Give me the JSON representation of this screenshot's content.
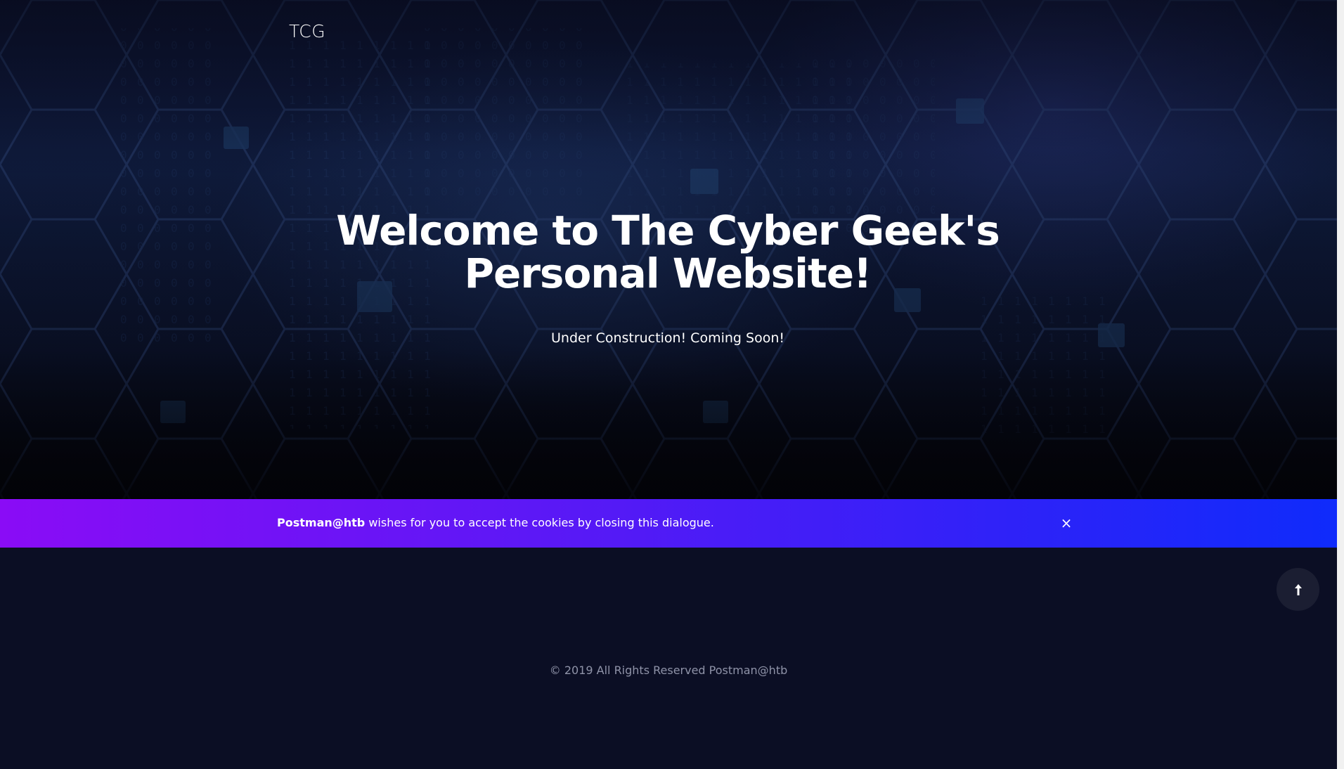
{
  "header": {
    "brand": "TCG"
  },
  "hero": {
    "title_line1": "Welcome to The Cyber Geek's",
    "title_line2": "Personal Website!",
    "subtitle": "Under Construction! Coming Soon!"
  },
  "cookie_bar": {
    "brand": "Postman@htb",
    "message": " wishes for you to accept the cookies by closing this dialogue.",
    "close_symbol": "×"
  },
  "back_to_top": {
    "icon": "arrow-up-icon"
  },
  "footer": {
    "copyright": "© 2019 All Rights Reserved Postman@htb"
  },
  "colors": {
    "background": "#0b0e24",
    "cookie_gradient_start": "#8a0cf6",
    "cookie_gradient_end": "#0f2bfb",
    "footer_text": "#8f93a8"
  }
}
